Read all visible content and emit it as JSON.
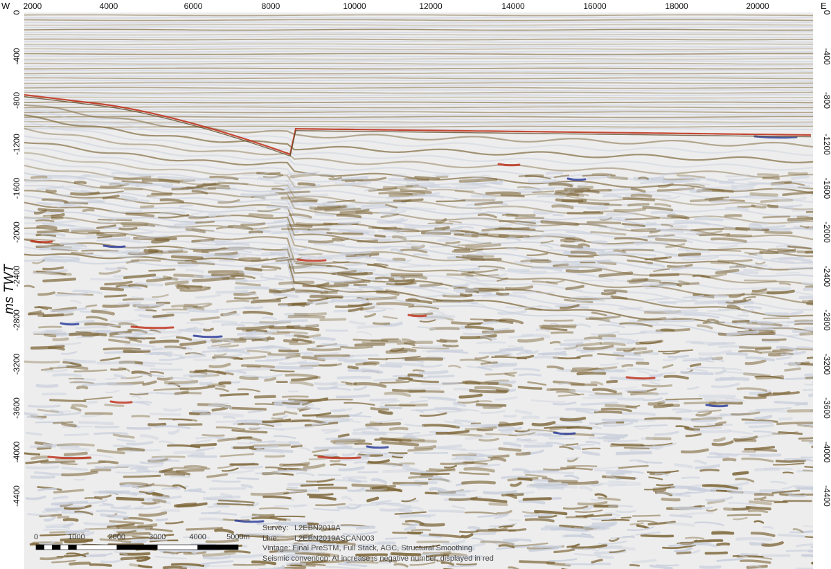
{
  "header": {
    "west_label": "W",
    "east_label": "E"
  },
  "x_axis": {
    "ticks": [
      "2000",
      "4000",
      "6000",
      "8000",
      "10000",
      "12000",
      "14000",
      "16000",
      "18000",
      "20000"
    ]
  },
  "y_axis": {
    "label": "ms TWT",
    "ticks_left": [
      "0",
      "-400",
      "-800",
      "-1200",
      "-1600",
      "-2000",
      "-2400",
      "-2800",
      "-3200",
      "-3600",
      "-4000",
      "-4400"
    ],
    "ticks_right": [
      "0",
      "-400",
      "-800",
      "-1200",
      "-1600",
      "-2000",
      "-2400",
      "-2800",
      "-3200",
      "-3600",
      "-4000",
      "-4400"
    ]
  },
  "scale_bar": {
    "labels": [
      "0",
      "1000",
      "2000",
      "3000",
      "4000",
      "5000m"
    ]
  },
  "info": {
    "survey_key": "Survey:",
    "survey_value": "L2EBN2019A",
    "line_key": "Line:",
    "line_value": "L2EBN2019ASCAN003",
    "vintage": "Vintage: Final PreSTM, Full Stack, AGC, Structural Smoothing",
    "convention": "Seismic convention: AI increase is negative number, displayed in red"
  },
  "colors": {
    "background": "#eeeeee",
    "trough": "#7d6638",
    "peak": "#c9cfdc",
    "strong_negative": "#c0341e",
    "strong_positive": "#2d3d9a",
    "horizon": "#5e4c2a"
  }
}
